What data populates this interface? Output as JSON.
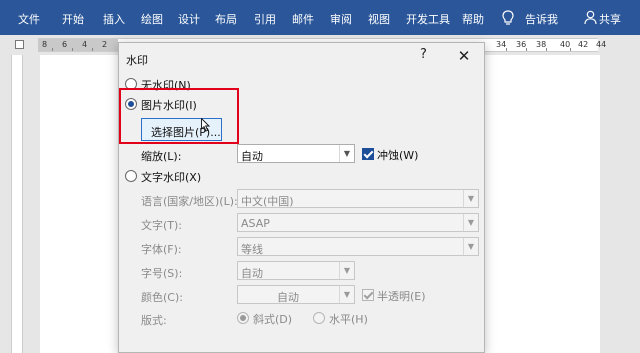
{
  "ribbon": {
    "tabs": [
      "文件",
      "开始",
      "插入",
      "绘图",
      "设计",
      "布局",
      "引用",
      "邮件",
      "审阅",
      "视图",
      "开发工具",
      "帮助"
    ],
    "tell_me": "告诉我",
    "share": "共享",
    "bg_color": "#2b579a"
  },
  "ruler": {
    "left_numbers": [
      "8",
      "6",
      "4",
      "2"
    ],
    "right_numbers": [
      "34",
      "36",
      "38",
      "40",
      "42",
      "44"
    ]
  },
  "dialog": {
    "title": "水印",
    "help": "?",
    "close": "✕",
    "no_watermark": "无水印(N)",
    "picture_watermark": "图片水印(I)",
    "select_picture_button": "选择图片(P)...",
    "scale_label": "缩放(L):",
    "scale_value": "自动",
    "washout_label": "冲蚀(W)",
    "text_watermark": "文字水印(X)",
    "language_label": "语言(国家/地区)(L):",
    "language_value": "中文(中国)",
    "text_label": "文字(T):",
    "text_value": "ASAP",
    "font_label": "字体(F):",
    "font_value": "等线",
    "size_label": "字号(S):",
    "size_value": "自动",
    "color_label": "颜色(C):",
    "color_value": "自动",
    "semitransparent_label": "半透明(E)",
    "layout_label": "版式:",
    "diagonal_label": "斜式(D)",
    "horizontal_label": "水平(H)",
    "selected_option": "picture_watermark"
  },
  "colors": {
    "highlight": "#e3001b",
    "accent": "#1f4e99"
  }
}
